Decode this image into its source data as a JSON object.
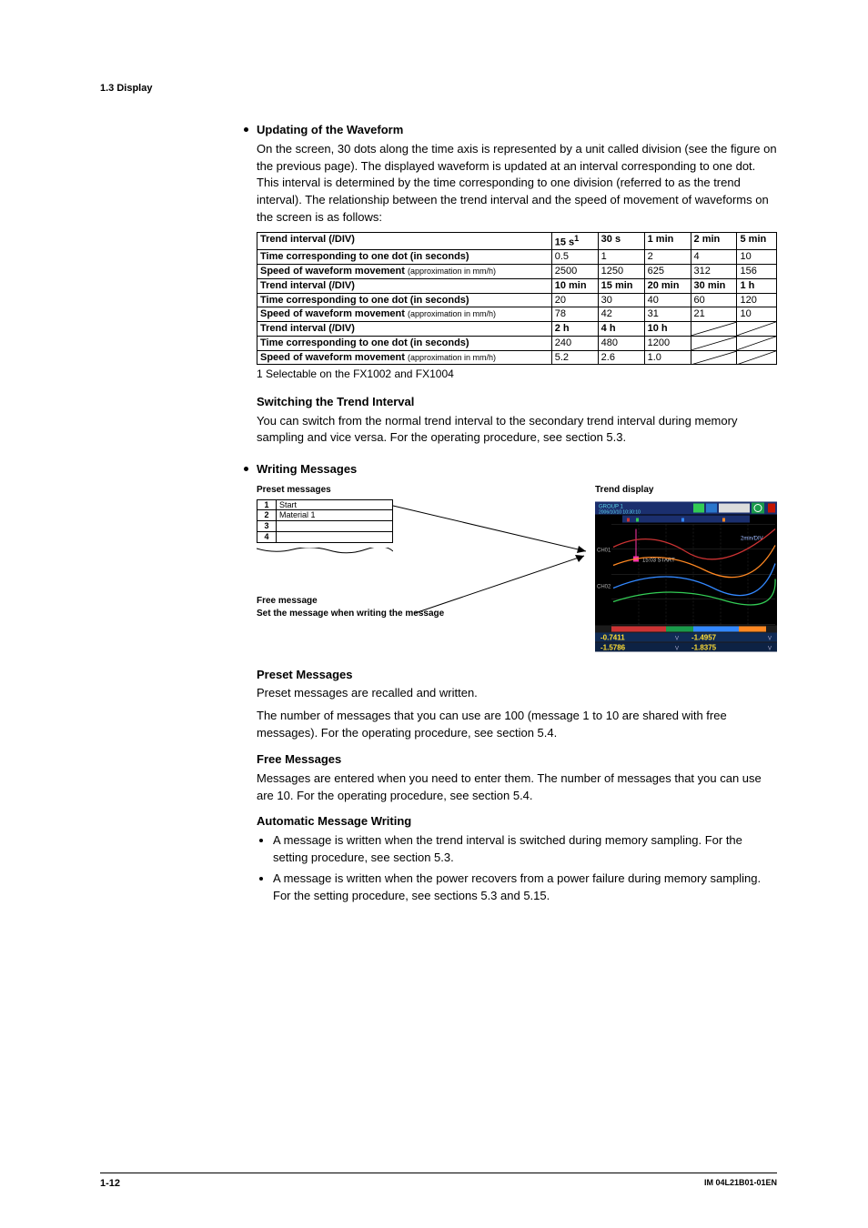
{
  "header": {
    "section": "1.3  Display"
  },
  "s1": {
    "title": "Updating of the Waveform",
    "para": "On the screen, 30 dots along the time axis is represented by a unit called division (see the figure on the previous page). The displayed waveform is updated at an interval corresponding to one dot. This interval is determined by the time corresponding to one division (referred to as the trend interval). The relationship between the trend interval and the speed of movement of waveforms on the screen is as follows:",
    "row_labels": {
      "interval": "Trend interval (/DIV)",
      "dot": "Time corresponding to one dot (in seconds)",
      "speed_a": "Speed of waveform movement ",
      "speed_b": "(approximation in mm/h)"
    },
    "rows": [
      {
        "cols": [
          "15 s",
          "30 s",
          "1 min",
          "2 min",
          "5 min"
        ],
        "sup": "1"
      },
      {
        "cols": [
          "0.5",
          "1",
          "2",
          "4",
          "10"
        ]
      },
      {
        "cols": [
          "2500",
          "1250",
          "625",
          "312",
          "156"
        ]
      },
      {
        "cols": [
          "10 min",
          "15 min",
          "20 min",
          "30 min",
          "1 h"
        ]
      },
      {
        "cols": [
          "20",
          "30",
          "40",
          "60",
          "120"
        ]
      },
      {
        "cols": [
          "78",
          "42",
          "31",
          "21",
          "10"
        ]
      },
      {
        "cols": [
          "2 h",
          "4 h",
          "10 h",
          "",
          ""
        ]
      },
      {
        "cols": [
          "240",
          "480",
          "1200",
          "",
          ""
        ]
      },
      {
        "cols": [
          "5.2",
          "2.6",
          "1.0",
          "",
          ""
        ]
      }
    ],
    "footnote": "1  Selectable on the FX1002 and FX1004"
  },
  "s2": {
    "title": "Switching the Trend Interval",
    "para": "You can switch from the normal trend interval to the secondary trend interval during memory sampling and vice versa. For the operating procedure, see section 5.3."
  },
  "s3": {
    "title": "Writing Messages",
    "preset_label": "Preset messages",
    "trend_label": "Trend display",
    "preset_rows": [
      {
        "n": "1",
        "t": "Start"
      },
      {
        "n": "2",
        "t": "Material 1"
      },
      {
        "n": "3",
        "t": ""
      },
      {
        "n": "4",
        "t": ""
      }
    ],
    "free_label": "Free message",
    "free_sub": "Set the message when writing the message",
    "trend_svg_text": {
      "group": "GROUP 1",
      "datetime": "2006/10/10 10:30:10",
      "ch1": "CH01",
      "ch2": "CH02",
      "rate": "2min/DIV",
      "msg": "15:03 START",
      "v1": "-0.7411",
      "u1": "V",
      "v2": "-1.4957",
      "u2": "V",
      "v3": "-1.5786",
      "u3": "V",
      "v4": "-1.8375",
      "u4": "V"
    }
  },
  "s4": {
    "title": "Preset Messages",
    "p1": "Preset messages are recalled and written.",
    "p2": "The number of messages that you can use are 100 (message 1 to 10 are shared with free messages). For the operating procedure, see section 5.4."
  },
  "s5": {
    "title": "Free Messages",
    "p1": "Messages are entered when you need to enter them. The number of messages that you can use are 10. For the operating procedure, see section 5.4."
  },
  "s6": {
    "title": "Automatic Message Writing",
    "li1": "A message is written when the trend interval is switched during memory sampling. For the setting procedure, see section 5.3.",
    "li2": "A message is written when the power recovers from a power failure during memory sampling. For the setting procedure, see sections 5.3 and 5.15."
  },
  "footer": {
    "page": "1-12",
    "doc": "IM 04L21B01-01EN"
  }
}
